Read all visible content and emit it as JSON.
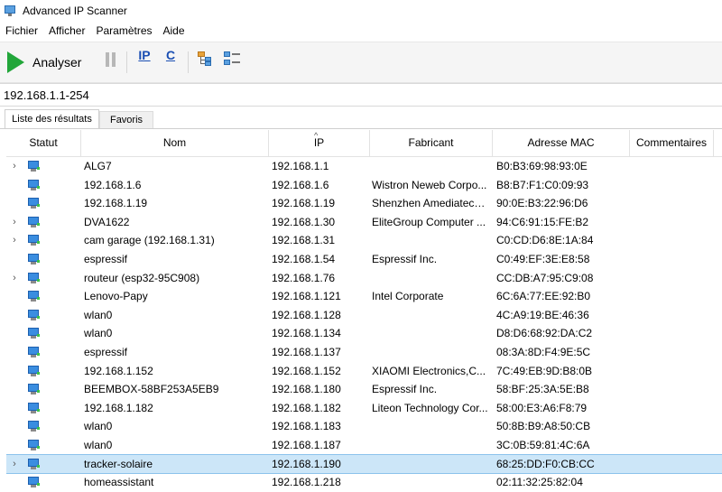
{
  "window": {
    "title": "Advanced IP Scanner"
  },
  "menu": [
    "Fichier",
    "Afficher",
    "Paramètres",
    "Aide"
  ],
  "toolbar": {
    "scan_label": "Analyser",
    "ip_label": "IP",
    "c_label": "C"
  },
  "address": {
    "value": "192.168.1.1-254"
  },
  "tabs": [
    {
      "label": "Liste des résultats"
    },
    {
      "label": "Favoris"
    }
  ],
  "columns": {
    "status": "Statut",
    "name": "Nom",
    "ip": "IP",
    "manufacturer": "Fabricant",
    "mac": "Adresse MAC",
    "comments": "Commentaires"
  },
  "colors": {
    "selected_row": "#cce6f8",
    "scan_green": "#22a63a",
    "accent_blue": "#1b4fb3"
  },
  "rows": [
    {
      "expandable": true,
      "name": "ALG7",
      "ip": "192.168.1.1",
      "manufacturer": "",
      "mac": "B0:B3:69:98:93:0E",
      "comments": ""
    },
    {
      "expandable": false,
      "name": "192.168.1.6",
      "ip": "192.168.1.6",
      "manufacturer": "Wistron Neweb Corpo...",
      "mac": "B8:B7:F1:C0:09:93",
      "comments": ""
    },
    {
      "expandable": false,
      "name": "192.168.1.19",
      "ip": "192.168.1.19",
      "manufacturer": "Shenzhen Amediatech...",
      "mac": "90:0E:B3:22:96:D6",
      "comments": ""
    },
    {
      "expandable": true,
      "name": "DVA1622",
      "ip": "192.168.1.30",
      "manufacturer": "EliteGroup Computer ...",
      "mac": "94:C6:91:15:FE:B2",
      "comments": ""
    },
    {
      "expandable": true,
      "name": "cam garage (192.168.1.31)",
      "ip": "192.168.1.31",
      "manufacturer": "",
      "mac": "C0:CD:D6:8E:1A:84",
      "comments": ""
    },
    {
      "expandable": false,
      "name": "espressif",
      "ip": "192.168.1.54",
      "manufacturer": "Espressif Inc.",
      "mac": "C0:49:EF:3E:E8:58",
      "comments": ""
    },
    {
      "expandable": true,
      "name": "routeur (esp32-95C908)",
      "ip": "192.168.1.76",
      "manufacturer": "",
      "mac": "CC:DB:A7:95:C9:08",
      "comments": ""
    },
    {
      "expandable": false,
      "name": "Lenovo-Papy",
      "ip": "192.168.1.121",
      "manufacturer": "Intel Corporate",
      "mac": "6C:6A:77:EE:92:B0",
      "comments": ""
    },
    {
      "expandable": false,
      "name": "wlan0",
      "ip": "192.168.1.128",
      "manufacturer": "",
      "mac": "4C:A9:19:BE:46:36",
      "comments": ""
    },
    {
      "expandable": false,
      "name": "wlan0",
      "ip": "192.168.1.134",
      "manufacturer": "",
      "mac": "D8:D6:68:92:DA:C2",
      "comments": ""
    },
    {
      "expandable": false,
      "name": "espressif",
      "ip": "192.168.1.137",
      "manufacturer": "",
      "mac": "08:3A:8D:F4:9E:5C",
      "comments": ""
    },
    {
      "expandable": false,
      "name": "192.168.1.152",
      "ip": "192.168.1.152",
      "manufacturer": "XIAOMI Electronics,C...",
      "mac": "7C:49:EB:9D:B8:0B",
      "comments": ""
    },
    {
      "expandable": false,
      "name": "BEEMBOX-58BF253A5EB9",
      "ip": "192.168.1.180",
      "manufacturer": "Espressif Inc.",
      "mac": "58:BF:25:3A:5E:B8",
      "comments": ""
    },
    {
      "expandable": false,
      "name": "192.168.1.182",
      "ip": "192.168.1.182",
      "manufacturer": "Liteon Technology Cor...",
      "mac": "58:00:E3:A6:F8:79",
      "comments": ""
    },
    {
      "expandable": false,
      "name": "wlan0",
      "ip": "192.168.1.183",
      "manufacturer": "",
      "mac": "50:8B:B9:A8:50:CB",
      "comments": ""
    },
    {
      "expandable": false,
      "name": "wlan0",
      "ip": "192.168.1.187",
      "manufacturer": "",
      "mac": "3C:0B:59:81:4C:6A",
      "comments": ""
    },
    {
      "expandable": true,
      "name": "tracker-solaire",
      "ip": "192.168.1.190",
      "manufacturer": "",
      "mac": "68:25:DD:F0:CB:CC",
      "comments": "",
      "selected": true
    },
    {
      "expandable": false,
      "name": "homeassistant",
      "ip": "192.168.1.218",
      "manufacturer": "",
      "mac": "02:11:32:25:82:04",
      "comments": ""
    }
  ]
}
